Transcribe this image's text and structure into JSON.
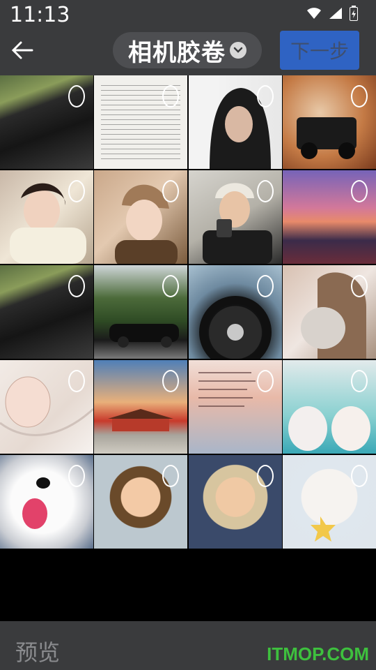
{
  "status": {
    "time": "11:13"
  },
  "header": {
    "album_title": "相机胶卷",
    "next_label": "下一步"
  },
  "grid": {
    "items": [
      {
        "icon": "car-interior-photo"
      },
      {
        "icon": "document-photo"
      },
      {
        "icon": "hoodie-portrait-photo"
      },
      {
        "icon": "offroad-car-photo"
      },
      {
        "icon": "girl-scarf-photo"
      },
      {
        "icon": "girl-hat-photo"
      },
      {
        "icon": "boy-camera-photo"
      },
      {
        "icon": "sunset-photo"
      },
      {
        "icon": "car-interior-photo"
      },
      {
        "icon": "street-car-photo"
      },
      {
        "icon": "steering-wheel-photo"
      },
      {
        "icon": "girl-cat-photo"
      },
      {
        "icon": "sketch-photo"
      },
      {
        "icon": "palace-photo"
      },
      {
        "icon": "handwritten-note-photo"
      },
      {
        "icon": "two-cats-photo"
      },
      {
        "icon": "dog-photo"
      },
      {
        "icon": "cartoon-boy-photo"
      },
      {
        "icon": "cartoon-boy-photo"
      },
      {
        "icon": "chibi-character-photo"
      }
    ]
  },
  "footer": {
    "preview_label": "预览",
    "watermark": "ITMOP.COM"
  },
  "colors": {
    "bar_bg": "#3a3b3d",
    "next_bg": "#2f63c3",
    "watermark": "#3ec03e"
  }
}
